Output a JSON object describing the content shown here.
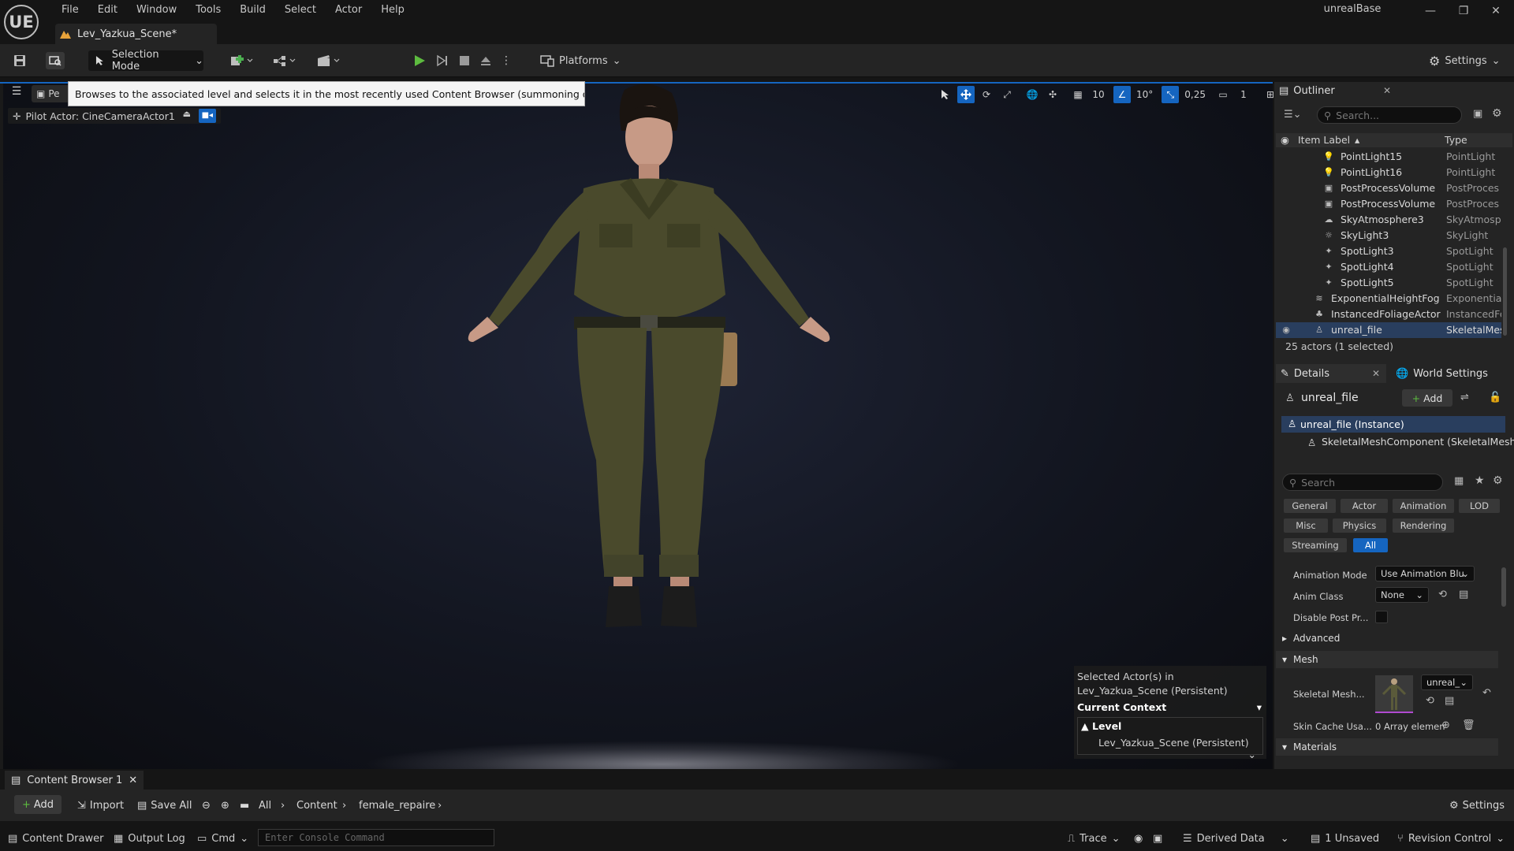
{
  "app": {
    "name": "unrealBase",
    "logo": "UE",
    "menu": [
      "File",
      "Edit",
      "Window",
      "Tools",
      "Build",
      "Select",
      "Actor",
      "Help"
    ],
    "window_controls": {
      "minimize": "—",
      "restore": "❐",
      "close": "✕"
    }
  },
  "document_tab": {
    "title": "Lev_Yazkua_Scene*"
  },
  "toolbar": {
    "selection_mode": "Selection Mode",
    "platforms": "Platforms",
    "settings": "Settings"
  },
  "viewport": {
    "perspective_label": "Pe",
    "tooltip": "Browses to the associated level and selects it in the most recently used Content Browser (summoning one if necessary)",
    "pilot_actor": "Pilot Actor: CineCameraActor1",
    "grid_snap": "10",
    "rotation_snap": "10°",
    "scale_snap": "0,25",
    "camera_speed": "1",
    "accent": "#1565c0",
    "context": {
      "selected_line1": "Selected Actor(s) in",
      "selected_line2": "Lev_Yazkua_Scene (Persistent)",
      "current_context": "Current Context",
      "level_label": "Level",
      "level_value": "Lev_Yazkua_Scene (Persistent)"
    }
  },
  "outliner": {
    "title": "Outliner",
    "search_placeholder": "Search...",
    "col_label": "Item Label",
    "col_type": "Type",
    "rows": [
      {
        "label": "PointLight15",
        "type": "PointLight",
        "icon": "point-light-icon",
        "indent": 1
      },
      {
        "label": "PointLight16",
        "type": "PointLight",
        "icon": "point-light-icon",
        "indent": 1
      },
      {
        "label": "PostProcessVolume",
        "type": "PostProces",
        "icon": "volume-icon",
        "indent": 1
      },
      {
        "label": "PostProcessVolume",
        "type": "PostProces",
        "icon": "volume-icon",
        "indent": 1
      },
      {
        "label": "SkyAtmosphere3",
        "type": "SkyAtmosp",
        "icon": "sky-atmosphere-icon",
        "indent": 1
      },
      {
        "label": "SkyLight3",
        "type": "SkyLight",
        "icon": "sky-light-icon",
        "indent": 1
      },
      {
        "label": "SpotLight3",
        "type": "SpotLight",
        "icon": "spot-light-icon",
        "indent": 1
      },
      {
        "label": "SpotLight4",
        "type": "SpotLight",
        "icon": "spot-light-icon",
        "indent": 1
      },
      {
        "label": "SpotLight5",
        "type": "SpotLight",
        "icon": "spot-light-icon",
        "indent": 1
      },
      {
        "label": "ExponentialHeightFog",
        "type": "Exponential",
        "icon": "fog-icon",
        "indent": 0
      },
      {
        "label": "InstancedFoliageActor",
        "type": "InstancedFo",
        "icon": "foliage-icon",
        "indent": 0
      },
      {
        "label": "unreal_file",
        "type": "SkeletalMes",
        "icon": "skeletal-mesh-icon",
        "indent": 0,
        "selected": true
      }
    ],
    "footer": "25 actors (1 selected)"
  },
  "details": {
    "tab_details": "Details",
    "tab_world": "World Settings",
    "actor_name": "unreal_file",
    "add_label": "Add",
    "instance_label": "unreal_file (Instance)",
    "component_label": "SkeletalMeshComponent (SkeletalMeshC",
    "search_placeholder": "Search",
    "categories": [
      "General",
      "Actor",
      "Animation",
      "LOD",
      "Misc",
      "Physics",
      "Rendering",
      "Streaming",
      "All"
    ],
    "active_category": "All",
    "props": {
      "animation_mode_label": "Animation Mode",
      "animation_mode_value": "Use Animation Blu",
      "anim_class_label": "Anim Class",
      "anim_class_value": "None",
      "disable_post_label": "Disable Post Pr...",
      "advanced": "Advanced",
      "mesh_section": "Mesh",
      "skeletal_mesh_label": "Skeletal Mesh...",
      "skeletal_mesh_value": "unreal_",
      "skin_cache_label": "Skin Cache Usa...",
      "skin_cache_value": "0 Array elemen",
      "materials_section": "Materials"
    }
  },
  "content_browser": {
    "tab": "Content Browser 1",
    "add": "Add",
    "import": "Import",
    "save_all": "Save All",
    "path": [
      "All",
      "Content",
      "female_repaire"
    ],
    "settings": "Settings"
  },
  "statusbar": {
    "content_drawer": "Content Drawer",
    "output_log": "Output Log",
    "cmd": "Cmd",
    "console_placeholder": "Enter Console Command",
    "trace": "Trace",
    "derived_data": "Derived Data",
    "unsaved": "1 Unsaved",
    "revision_control": "Revision Control"
  }
}
